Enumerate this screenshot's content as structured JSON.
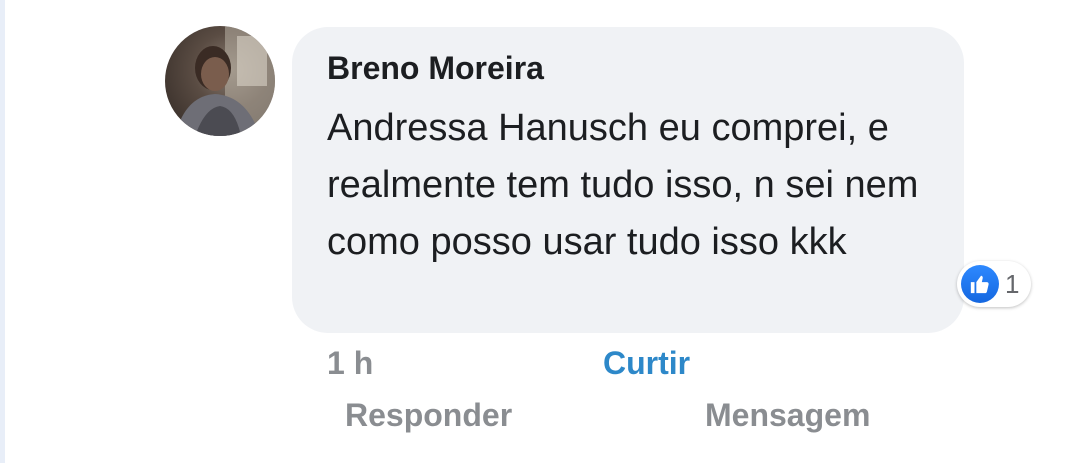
{
  "comment": {
    "author": "Breno Moreira",
    "text": "Andressa Hanusch eu comprei, e realmente tem tudo isso, n sei nem como posso usar tudo isso kkk",
    "time": "1 h",
    "like_label": "Curtir",
    "reaction": {
      "icon": "thumbs-up-icon",
      "count": "1"
    }
  },
  "actions": {
    "reply_label": "Responder",
    "message_label": "Mensagem"
  },
  "colors": {
    "bubble_bg": "#f0f2f5",
    "link_blue": "#2d88c9",
    "muted_text": "#8a8d91",
    "like_blue": "#1877f2"
  }
}
